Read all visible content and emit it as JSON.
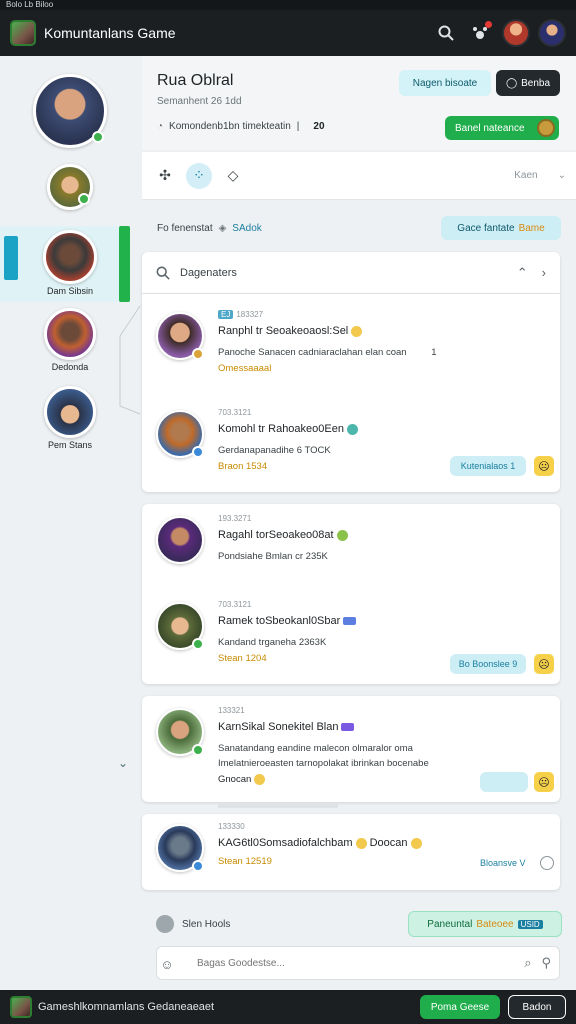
{
  "statusbar": {
    "text": "Bolo Lb Biloo"
  },
  "header": {
    "app_title": "Komuntanlans Game"
  },
  "sidebar": {
    "active_tag": "",
    "items": [
      {
        "label": ""
      },
      {
        "label": ""
      },
      {
        "label": "Dam Sibsin"
      },
      {
        "label": "Dedonda"
      },
      {
        "label": "Pem Stans"
      }
    ]
  },
  "profile": {
    "name": "Rua Oblral",
    "subtitle": "Semanhent 26 1dd",
    "meta": "Komondenb1bn timekteatin",
    "meta_sep": "|",
    "count": "20",
    "btn_primary": "Nagen bisoate",
    "btn_dark": "Benba",
    "btn_green": "Banel nateance"
  },
  "toolbar": {
    "right_label": "Kaen"
  },
  "filter": {
    "label": "Fo fenenstat",
    "link": "SAdok",
    "button": "Gace fantate",
    "button_accent": "Bame"
  },
  "search": {
    "label": "Dagenaters"
  },
  "messages": [
    {
      "time_tag": "EJ",
      "time": "183327",
      "name": "Ranphl tr Seoakeoaosl:Sel",
      "text": "Panoche Sanacen cadniaraclahan elan coan",
      "aside": "1",
      "link": "Omessaaaal",
      "reply": "",
      "reply_count": ""
    },
    {
      "time_tag": "",
      "time": "703.3121",
      "name": "Komohl tr Rahoakeo0Een",
      "text": "Gerdanapanadihe 6 TOCK",
      "aside": "",
      "link": "Braon 1534",
      "reply": "Kutenialaos",
      "reply_count": "1"
    },
    {
      "time_tag": "",
      "time": "193.3271",
      "name": "Ragahl torSeoakeo08at",
      "text": "Pondsiahe Bmlan cr 235K",
      "aside": "",
      "link": "",
      "reply": "",
      "reply_count": ""
    },
    {
      "time_tag": "",
      "time": "703.3121",
      "name": "Ramek toSbeokanl0Sbar",
      "text": "Kandand trganeha 2363K",
      "aside": "",
      "link": "Stean 1204",
      "reply": "Bo Boonslee",
      "reply_count": "9"
    },
    {
      "time_tag": "",
      "time": "133321",
      "name": "KarnSikal Sonekitel Blan",
      "text": "Sanatandang eandine malecon olmaralor oma",
      "text2": "Imelatnieroeasten tarnopolakat ibrinkan bocenabe",
      "link": "Gnocan",
      "reply": "",
      "reply_count": ""
    },
    {
      "time_tag": "",
      "time": "133330",
      "name": "KAG6tl0Somsadiofalchbam",
      "after": "Doocan",
      "link": "Stean 12519",
      "reply": "Bloansve V",
      "reply_count": ""
    }
  ],
  "bottom": {
    "user": "Slen Hools",
    "send_label": "Paneuntal",
    "send_accent": "Bateoee",
    "send_chip": "USID"
  },
  "compose": {
    "placeholder": "Bagas Goodestse..."
  },
  "footer": {
    "title": "Gameshlkomnamlans Gedaneaeaet",
    "btn_green": "Poma Geese",
    "btn_dark": "Badon"
  }
}
